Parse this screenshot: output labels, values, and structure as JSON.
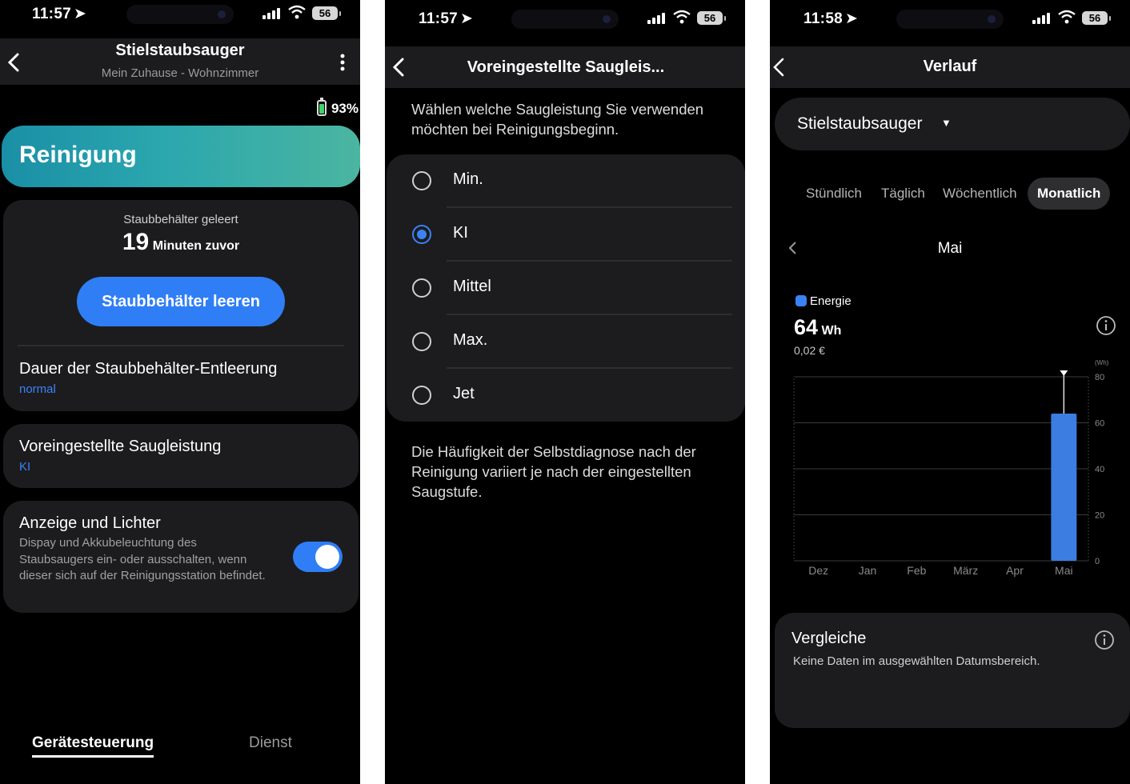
{
  "screen1": {
    "status": {
      "time": "11:57",
      "battery": "56"
    },
    "title": "Stielstaubsauger",
    "subtitle": "Mein Zuhause - Wohnzimmer",
    "device_battery": "93%",
    "hero_label": "Reinigung",
    "dust_emptied_label": "Staubbehälter geleert",
    "dust_minutes": "19",
    "dust_minutes_suffix": "Minuten zuvor",
    "empty_button": "Staubbehälter leeren",
    "duration_title": "Dauer der Staubbehälter-Entleerung",
    "duration_value": "normal",
    "suction_title": "Voreingestellte Saugleistung",
    "suction_value": "KI",
    "display_title": "Anzeige und Lichter",
    "display_desc": "Dispay und Akkubeleuchtung des Staubsaugers ein- oder ausschalten, wenn dieser sich auf der Reinigungsstation befindet.",
    "display_toggle_on": true,
    "nav_device": "Gerätesteuerung",
    "nav_service": "Dienst"
  },
  "screen2": {
    "status": {
      "time": "11:57",
      "battery": "56"
    },
    "title": "Voreingestellte Saugleis...",
    "intro": "Wählen welche Saugleistung Sie verwenden möchten bei Reinigungsbeginn.",
    "options": [
      "Min.",
      "KI",
      "Mittel",
      "Max.",
      "Jet"
    ],
    "selected": "KI",
    "footnote": "Die Häufigkeit der Selbstdiagnose nach der Reinigung variiert je nach der eingestellten Saugstufe."
  },
  "screen3": {
    "status": {
      "time": "11:58",
      "battery": "56"
    },
    "title": "Verlauf",
    "device_select": "Stielstaubsauger",
    "tabs": [
      "Stündlich",
      "Täglich",
      "Wöchentlich",
      "Monatlich"
    ],
    "active_tab": "Monatlich",
    "period": "Mai",
    "legend_label": "Energie",
    "energy_value": "64",
    "energy_unit": "Wh",
    "cost": "0,02 €",
    "compare_title": "Vergleiche",
    "compare_text": "Keine Daten im ausgewählten Datumsbereich."
  },
  "colors": {
    "accent": "#2f7ef6",
    "card": "#1c1c1e",
    "bar": "#3b7de0",
    "hero_start": "#1a8fa6",
    "hero_end": "#4bb5a0"
  },
  "chart_data": {
    "type": "bar",
    "categories": [
      "Dez",
      "Jan",
      "Feb",
      "März",
      "Apr",
      "Mai"
    ],
    "series": [
      {
        "name": "Energie",
        "values": [
          0,
          0,
          0,
          0,
          0,
          64
        ]
      }
    ],
    "ylabel": "(Wh)",
    "ylim": [
      0,
      80
    ],
    "yticks": [
      0,
      20,
      40,
      60,
      80
    ],
    "grid": true,
    "marker_category": "Mai"
  }
}
